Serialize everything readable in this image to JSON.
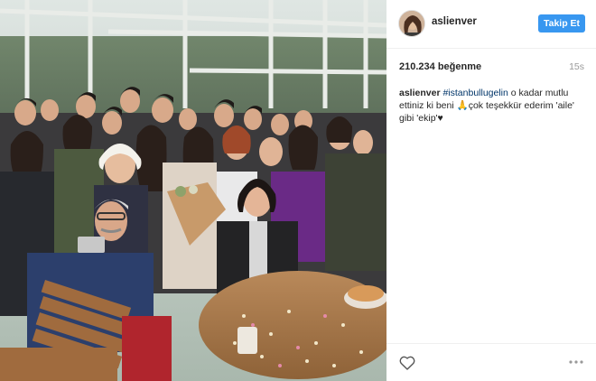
{
  "post": {
    "username": "aslienver",
    "follow_label": "Takip Et",
    "likes": "210.234 beğenme",
    "time_ago": "15s",
    "caption": {
      "user": "aslienver",
      "hashtag": "#istanbullugelin",
      "text_1": " o kadar mutlu ettiniz ki beni ",
      "emoji": "🙏",
      "text_2": "çok teşekkür ederim 'aile' gibi 'ekip'♥"
    },
    "icons": {
      "like": "heart-icon",
      "options": "more-options-icon"
    },
    "colors": {
      "follow_button": "#3897f0",
      "hashtag": "#003569",
      "time": "#999999"
    }
  }
}
